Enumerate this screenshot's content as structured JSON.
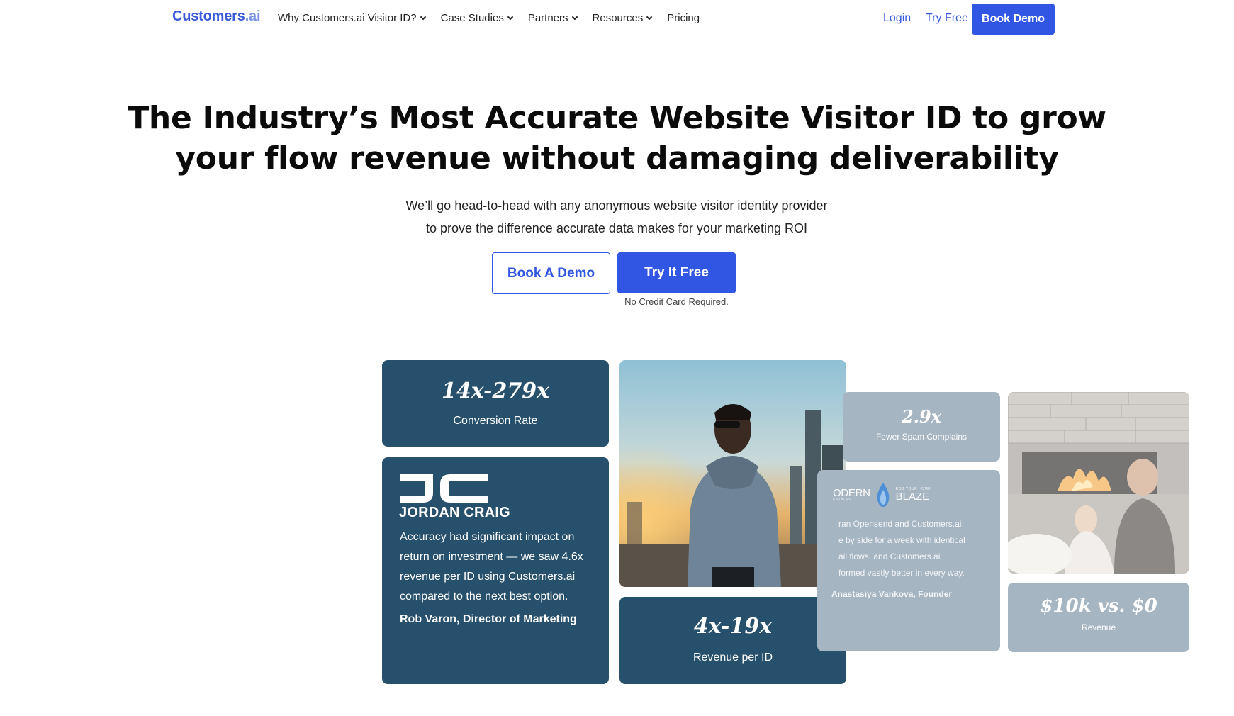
{
  "nav": {
    "logo_main": "Customers",
    "logo_suffix": ".ai",
    "links": [
      {
        "label": "Why Customers.ai Visitor ID?"
      },
      {
        "label": "Case Studies"
      },
      {
        "label": "Partners"
      },
      {
        "label": "Resources"
      },
      {
        "label": "Pricing"
      }
    ],
    "login": "Login",
    "try_free": "Try Free",
    "book_demo": "Book Demo"
  },
  "hero": {
    "headline_line1": "The Industry’s Most Accurate Website Visitor ID to grow",
    "headline_line2": "your flow revenue without damaging deliverability",
    "sub_line1": "We’ll go head-to-head with any anonymous website visitor identity provider",
    "sub_line2": "to prove the difference accurate data makes for your marketing ROI",
    "btn_book": "Book A Demo",
    "btn_try": "Try It Free",
    "no_cc": "No Credit Card Required."
  },
  "cards": {
    "conversion": {
      "value": "14x-279x",
      "label": "Conversion Rate"
    },
    "jordan": {
      "brand": "JORDAN CRAIG",
      "quote": "Accuracy had significant impact on return on investment — we saw 4.6x revenue per ID using Customers.ai compared to the next best option.",
      "attrib": "Rob Varon, Director of Marketing"
    },
    "revenue_per_id": {
      "value": "4x-19x",
      "label": "Revenue per ID"
    },
    "spam": {
      "value": "2.9x",
      "label": "Fewer Spam Complains"
    },
    "modern_blaze": {
      "brand_left": "ODERN",
      "brand_small_left": "ESTYLES",
      "brand_small_right": "ROB YOUR HOME",
      "brand_right": "BLAZE",
      "quote": "ran Opensend and Customers.ai\ne by side for a week with identical\nail flows, and Customers.ai\nformed vastly better in every way.",
      "attrib": "Anastasiya Vankova, Founder"
    },
    "revenue": {
      "value": "$10k vs. $0",
      "label": "Revenue"
    }
  },
  "colors": {
    "accent": "#3056e3",
    "card_dark": "#26506b",
    "card_faded": "#a5b5c2"
  }
}
